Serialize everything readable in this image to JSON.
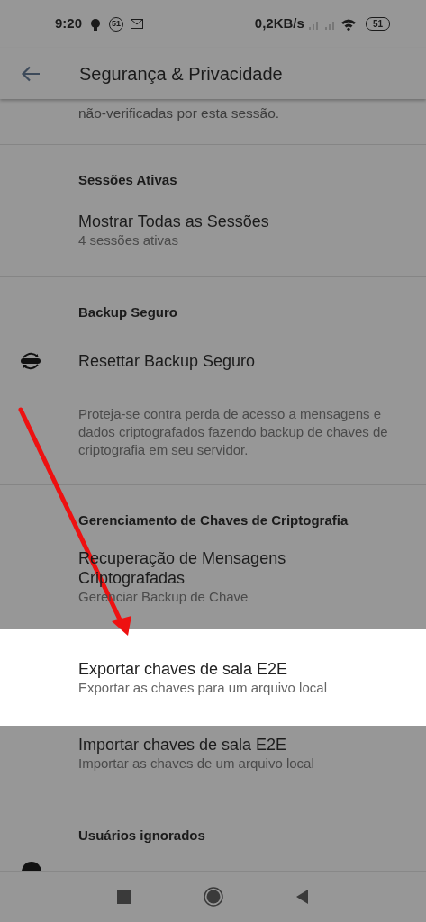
{
  "status_bar": {
    "time": "9:20",
    "notification_count": "51",
    "speed": "0,2KB/s",
    "battery": "51"
  },
  "app_bar": {
    "title": "Segurança & Privacidade"
  },
  "top_note": "não-verificadas por esta sessão.",
  "sections": [
    {
      "header": "Sessões Ativas",
      "items": [
        {
          "kind": "item",
          "title": "Mostrar Todas as Sessões",
          "subtitle": "4 sessões ativas",
          "highlighted": false
        }
      ]
    },
    {
      "header": "Backup Seguro",
      "items": [
        {
          "kind": "icon-item",
          "title": "Resettar Backup Seguro",
          "highlighted": false
        },
        {
          "kind": "note",
          "text": "Proteja-se contra perda de acesso a mensagens e dados criptografados fazendo backup de chaves de criptografia em seu servidor."
        }
      ]
    },
    {
      "header": "Gerenciamento de Chaves de Criptografia",
      "items": [
        {
          "kind": "item",
          "title": "Recuperação de Mensagens Criptografadas",
          "subtitle": "Gerenciar Backup de Chave",
          "highlighted": false
        },
        {
          "kind": "item",
          "title": "Exportar chaves de sala E2E",
          "subtitle": "Exportar as chaves para um arquivo local",
          "highlighted": true
        },
        {
          "kind": "item",
          "title": "Importar chaves de sala E2E",
          "subtitle": "Importar as chaves de um arquivo local",
          "highlighted": false
        }
      ]
    },
    {
      "header": "Usuários ignorados",
      "items": [
        {
          "kind": "partial"
        }
      ]
    }
  ]
}
